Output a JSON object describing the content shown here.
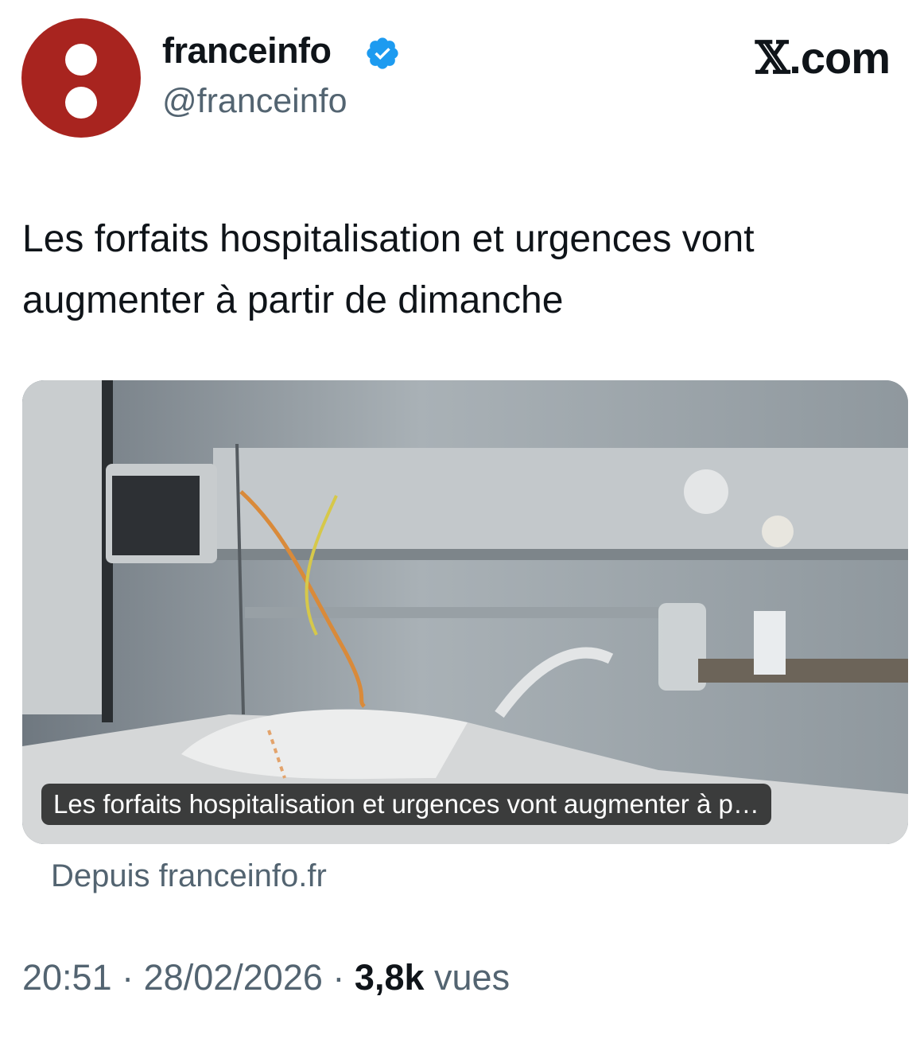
{
  "author": {
    "name": "franceinfo",
    "handle": "@franceinfo",
    "verified": true,
    "avatar_color": "#a8241f",
    "verified_color": "#1d9bf0"
  },
  "brand": {
    "logo_letter": "𝕏",
    "suffix": ".com"
  },
  "tweet": {
    "text": "Les forfaits hospitalisation et urgences vont augmenter à partir de dimanche"
  },
  "card": {
    "caption": "Les forfaits hospitalisation et urgences vont augmenter à p…",
    "source": "Depuis franceinfo.fr"
  },
  "meta": {
    "time": "20:51",
    "separator": "·",
    "date": "28/02/2026",
    "views_count": "3,8k",
    "views_label": "vues"
  },
  "icons": {
    "verified": "verified-badge-icon",
    "avatar": "franceinfo-logo"
  }
}
